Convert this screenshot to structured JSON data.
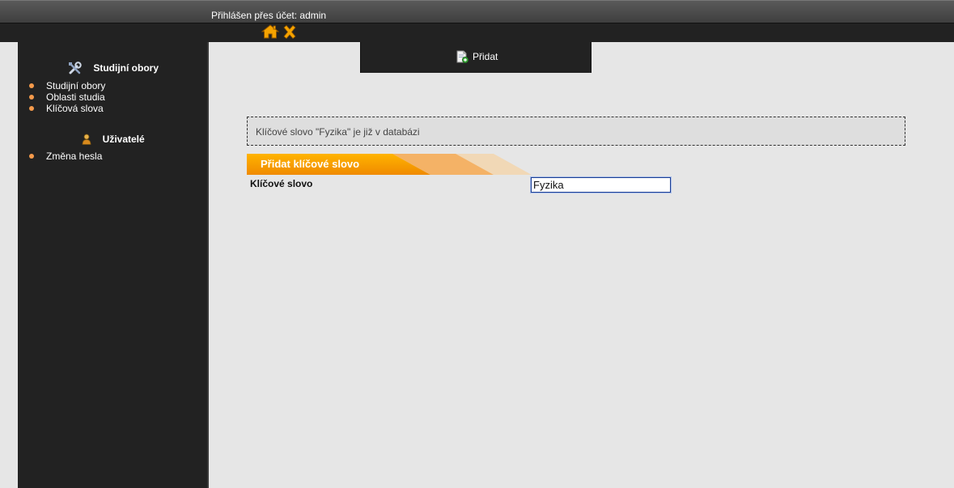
{
  "header": {
    "login_text": "Přihlášen přes účet: admin",
    "icons": [
      "home-icon",
      "close-icon"
    ]
  },
  "sidebar": {
    "sections": [
      {
        "title": "Studijní obory",
        "icon": "tools-icon",
        "items": [
          "Studijní obory",
          "Oblasti studia",
          "Klíčová slova"
        ]
      },
      {
        "title": "Uživatelé",
        "icon": "user-icon",
        "items": [
          "Změna hesla"
        ]
      }
    ]
  },
  "tab": {
    "label": "Přidat",
    "icon": "add-document-icon"
  },
  "message": "Klíčové slovo \"Fyzika\" je již v databázi",
  "form": {
    "header": "Přidat klíčové slovo",
    "field_label": "Klíčové slovo",
    "field_value": "Fyzika"
  },
  "colors": {
    "accent": "#f5a000",
    "dark": "#222222",
    "background": "#e6e6e6",
    "bullet": "#f59a4b"
  }
}
